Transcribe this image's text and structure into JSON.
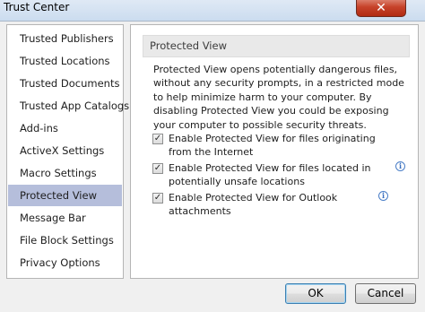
{
  "window": {
    "title": "Trust Center",
    "close_glyph": "✕"
  },
  "sidebar": {
    "items": [
      {
        "label": "Trusted Publishers",
        "selected": false
      },
      {
        "label": "Trusted Locations",
        "selected": false
      },
      {
        "label": "Trusted Documents",
        "selected": false
      },
      {
        "label": "Trusted App Catalogs",
        "selected": false
      },
      {
        "label": "Add-ins",
        "selected": false
      },
      {
        "label": "ActiveX Settings",
        "selected": false
      },
      {
        "label": "Macro Settings",
        "selected": false
      },
      {
        "label": "Protected View",
        "selected": true
      },
      {
        "label": "Message Bar",
        "selected": false
      },
      {
        "label": "File Block Settings",
        "selected": false
      },
      {
        "label": "Privacy Options",
        "selected": false
      }
    ]
  },
  "main": {
    "section_title": "Protected View",
    "description": "Protected View opens potentially dangerous files, without any security prompts, in a restricted mode to help minimize harm to your computer. By disabling Protected View you could be exposing your computer to possible security threats.",
    "options": [
      {
        "label": "Enable Protected View for files originating from the Internet",
        "checked": true,
        "info": false
      },
      {
        "label": "Enable Protected View for files located in potentially unsafe locations",
        "checked": true,
        "info": true
      },
      {
        "label": "Enable Protected View for Outlook attachments",
        "checked": true,
        "info": true
      }
    ]
  },
  "footer": {
    "ok_label": "OK",
    "cancel_label": "Cancel"
  },
  "icons": {
    "check_glyph": "✓",
    "info_glyph": "i"
  }
}
